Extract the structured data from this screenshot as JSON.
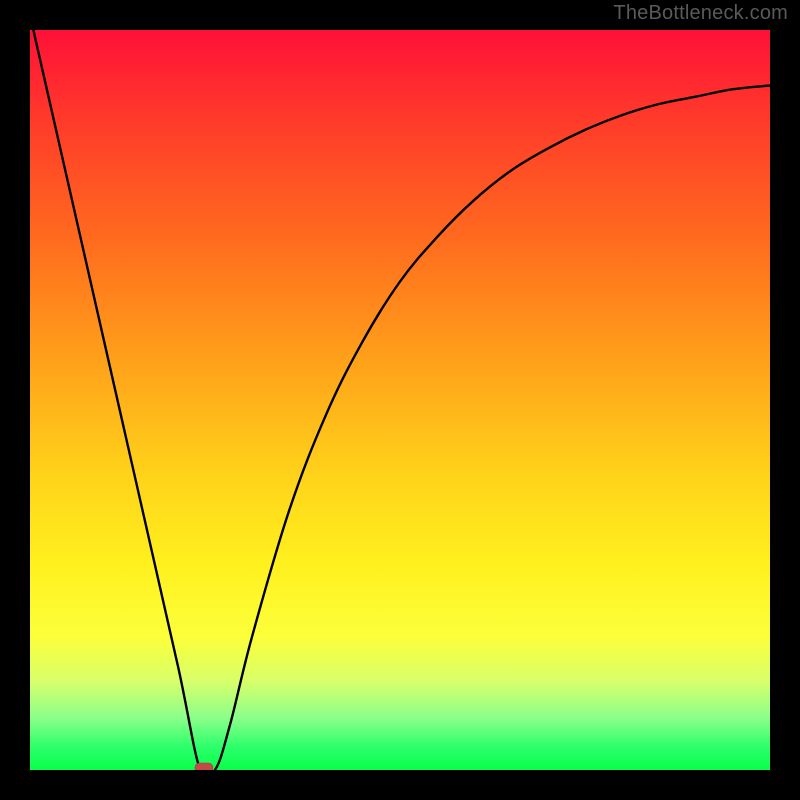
{
  "watermark": "TheBottleneck.com",
  "chart_data": {
    "type": "line",
    "title": "",
    "xlabel": "",
    "ylabel": "",
    "xlim": [
      0,
      100
    ],
    "ylim": [
      0,
      100
    ],
    "grid": false,
    "series": [
      {
        "name": "curve",
        "x": [
          0,
          5,
          10,
          15,
          20,
          23,
          25,
          27,
          30,
          35,
          40,
          45,
          50,
          55,
          60,
          65,
          70,
          75,
          80,
          85,
          90,
          95,
          100
        ],
        "y": [
          102,
          80,
          58,
          36,
          14,
          0,
          0,
          6,
          18,
          35,
          48,
          58,
          66,
          72,
          77,
          81,
          84,
          86.5,
          88.5,
          90,
          91,
          92,
          92.5
        ]
      }
    ],
    "marker": {
      "x": 23.5,
      "y": 0,
      "color": "#c44a4a",
      "shape": "rounded-bar"
    },
    "background_gradient": {
      "top": "#ff1038",
      "bottom": "#0aff4a",
      "meaning": "red high to green low"
    }
  }
}
